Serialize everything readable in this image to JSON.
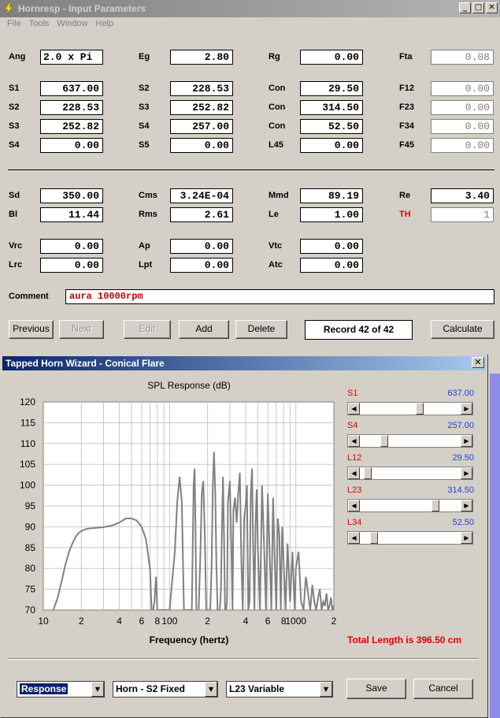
{
  "window": {
    "title": "Hornresp - Input Parameters"
  },
  "menu": [
    "File",
    "Tools",
    "Window",
    "Help"
  ],
  "params": {
    "ang": {
      "label": "Ang",
      "value": "2.0 x Pi"
    },
    "eg": {
      "label": "Eg",
      "value": "2.80"
    },
    "rg": {
      "label": "Rg",
      "value": "0.00"
    },
    "fta": {
      "label": "Fta",
      "value": "0.08"
    },
    "s1": {
      "label": "S1",
      "value": "637.00"
    },
    "s2a": {
      "label": "S2",
      "value": "228.53"
    },
    "con1": {
      "label": "Con",
      "value": "29.50"
    },
    "f12": {
      "label": "F12",
      "value": "0.00"
    },
    "s2": {
      "label": "S2",
      "value": "228.53"
    },
    "s3a": {
      "label": "S3",
      "value": "252.82"
    },
    "con2": {
      "label": "Con",
      "value": "314.50"
    },
    "f23": {
      "label": "F23",
      "value": "0.00"
    },
    "s3": {
      "label": "S3",
      "value": "252.82"
    },
    "s4a": {
      "label": "S4",
      "value": "257.00"
    },
    "con3": {
      "label": "Con",
      "value": "52.50"
    },
    "f34": {
      "label": "F34",
      "value": "0.00"
    },
    "s4": {
      "label": "S4",
      "value": "0.00"
    },
    "s5": {
      "label": "S5",
      "value": "0.00"
    },
    "l45": {
      "label": "L45",
      "value": "0.00"
    },
    "f45": {
      "label": "F45",
      "value": "0.00"
    },
    "sd": {
      "label": "Sd",
      "value": "350.00"
    },
    "cms": {
      "label": "Cms",
      "value": "3.24E-04"
    },
    "mmd": {
      "label": "Mmd",
      "value": "89.19"
    },
    "re": {
      "label": "Re",
      "value": "3.40"
    },
    "bl": {
      "label": "Bl",
      "value": "11.44"
    },
    "rms": {
      "label": "Rms",
      "value": "2.61"
    },
    "le": {
      "label": "Le",
      "value": "1.00"
    },
    "th": {
      "label": "TH",
      "value": "1"
    },
    "vrc": {
      "label": "Vrc",
      "value": "0.00"
    },
    "ap": {
      "label": "Ap",
      "value": "0.00"
    },
    "vtc": {
      "label": "Vtc",
      "value": "0.00"
    },
    "lrc": {
      "label": "Lrc",
      "value": "0.00"
    },
    "lpt": {
      "label": "Lpt",
      "value": "0.00"
    },
    "atc": {
      "label": "Atc",
      "value": "0.00"
    }
  },
  "comment": {
    "label": "Comment",
    "value": "aura 10000rpm"
  },
  "buttons": {
    "previous": "Previous",
    "next": "Next",
    "edit": "Edit",
    "add": "Add",
    "delete": "Delete",
    "record": "Record 42 of 42",
    "calculate": "Calculate"
  },
  "wizard": {
    "title": "Tapped Horn Wizard - Conical Flare",
    "close": "✕",
    "total_length": "Total Length is 396.50 cm",
    "sliders": [
      {
        "name": "S1",
        "value": "637.00",
        "position": 0.6
      },
      {
        "name": "S4",
        "value": "257.00",
        "position": 0.22
      },
      {
        "name": "L12",
        "value": "29.50",
        "position": 0.04
      },
      {
        "name": "L23",
        "value": "314.50",
        "position": 0.77
      },
      {
        "name": "L34",
        "value": "52.50",
        "position": 0.11
      }
    ],
    "combos": [
      {
        "value": "Response"
      },
      {
        "value": "Horn - S2 Fixed"
      },
      {
        "value": "L23 Variable"
      }
    ],
    "save": "Save",
    "cancel": "Cancel"
  },
  "chart_data": {
    "type": "line",
    "title": "SPL Response (dB)",
    "xlabel": "Frequency (hertz)",
    "ylabel": "",
    "xscale": "log",
    "xlim": [
      10,
      2000
    ],
    "ylim": [
      70,
      120
    ],
    "yticks": [
      70,
      75,
      80,
      85,
      90,
      95,
      100,
      105,
      110,
      115,
      120
    ],
    "xtick_labels": [
      {
        "x": 10,
        "label": "10"
      },
      {
        "x": 20,
        "label": "2"
      },
      {
        "x": 40,
        "label": "4"
      },
      {
        "x": 60,
        "label": "6"
      },
      {
        "x": 80,
        "label": "8"
      },
      {
        "x": 100,
        "label": "100"
      },
      {
        "x": 200,
        "label": "2"
      },
      {
        "x": 400,
        "label": "4"
      },
      {
        "x": 600,
        "label": "6"
      },
      {
        "x": 800,
        "label": "8"
      },
      {
        "x": 1000,
        "label": "1000"
      },
      {
        "x": 2000,
        "label": "2"
      }
    ],
    "grid": true,
    "series": [
      {
        "color": "#808080",
        "x": [
          12,
          13,
          14,
          15,
          16,
          17,
          18,
          19,
          20,
          22,
          25,
          30,
          35,
          40,
          45,
          50,
          55,
          60,
          65,
          70,
          72,
          74,
          76,
          78,
          80,
          82,
          85,
          88,
          90,
          92,
          95,
          100,
          110,
          115,
          120,
          125,
          130,
          135,
          140,
          145,
          150,
          155,
          158,
          160,
          163,
          166,
          170,
          175,
          180,
          185,
          190,
          195,
          200,
          205,
          210,
          215,
          220,
          225,
          230,
          235,
          240,
          250,
          255,
          260,
          265,
          270,
          275,
          280,
          285,
          290,
          300,
          310,
          315,
          320,
          330,
          340,
          350,
          360,
          370,
          380,
          390,
          400,
          410,
          420,
          430,
          440,
          450,
          460,
          470,
          480,
          490,
          500,
          520,
          540,
          560,
          580,
          600,
          620,
          640,
          660,
          680,
          700,
          720,
          740,
          760,
          780,
          800,
          830,
          860,
          900,
          940,
          980,
          1000,
          1050,
          1100,
          1150,
          1200,
          1250,
          1300,
          1350,
          1400,
          1450,
          1500,
          1550,
          1600,
          1650,
          1700,
          1750,
          1800,
          1850,
          1900,
          1950,
          2000
        ],
        "y": [
          70,
          73,
          77,
          81,
          84,
          86,
          87.5,
          88.5,
          89,
          89.5,
          89.7,
          89.9,
          90.3,
          91,
          92,
          92,
          91.5,
          90,
          87,
          80,
          70,
          70,
          72,
          78,
          70,
          70,
          70,
          70,
          70,
          70,
          70,
          70,
          84,
          96,
          102,
          96,
          70,
          70,
          70,
          70,
          70,
          100,
          104,
          92,
          70,
          70,
          70,
          82,
          98,
          101,
          88,
          70,
          70,
          70,
          70,
          80,
          100,
          108,
          98,
          80,
          70,
          70,
          75,
          90,
          102,
          88,
          70,
          70,
          72,
          96,
          101,
          82,
          70,
          94,
          97,
          91,
          98,
          103,
          82,
          70,
          92,
          95,
          100,
          70,
          72,
          98,
          104,
          84,
          70,
          91,
          99,
          85,
          70,
          100,
          86,
          70,
          98,
          84,
          70,
          97,
          82,
          70,
          92,
          88,
          70,
          90,
          82,
          70,
          86,
          72,
          84,
          70,
          80,
          84,
          72,
          70,
          78,
          74,
          70,
          76,
          72,
          70,
          73,
          75,
          70,
          72,
          71,
          74,
          70,
          71,
          73,
          70,
          71
        ]
      }
    ]
  }
}
